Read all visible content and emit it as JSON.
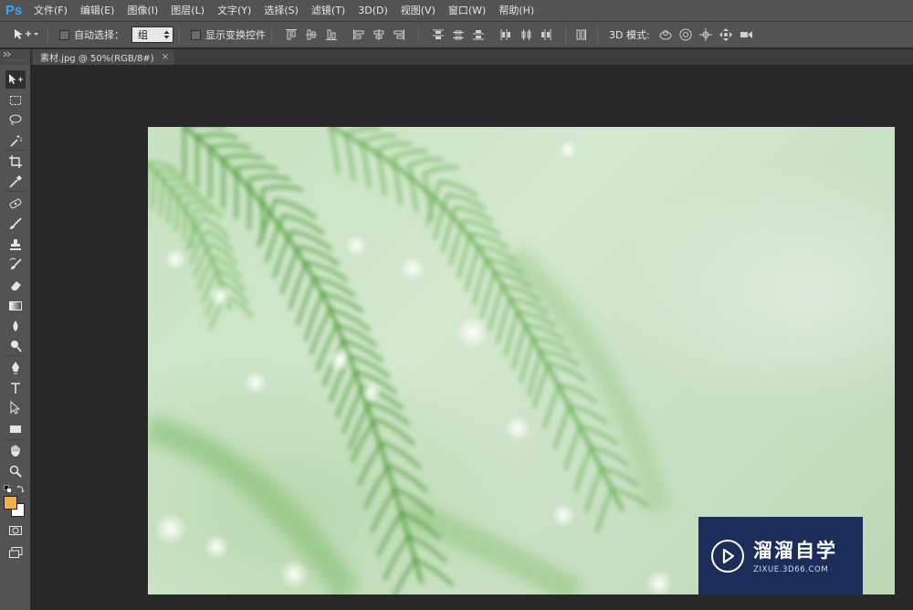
{
  "app": {
    "logo": "Ps",
    "menu": [
      "文件(F)",
      "编辑(E)",
      "图像(I)",
      "图层(L)",
      "文字(Y)",
      "选择(S)",
      "滤镜(T)",
      "3D(D)",
      "视图(V)",
      "窗口(W)",
      "帮助(H)"
    ]
  },
  "options": {
    "auto_select_label": "自动选择：",
    "auto_select_value": "组",
    "show_transform_label": "显示变换控件",
    "mode_label": "3D 模式:"
  },
  "document": {
    "tab_label": "素材.jpg @ 50%(RGB/8#)",
    "close_glyph": "×"
  },
  "colors": {
    "foreground": "#f0b04a",
    "background": "#ffffff",
    "ui_panel": "#535353",
    "workspace": "#282828"
  },
  "tools": [
    "move-tool-icon",
    "marquee-tool-icon",
    "lasso-tool-icon",
    "magic-wand-icon",
    "crop-tool-icon",
    "eyedropper-icon",
    "healing-brush-icon",
    "brush-tool-icon",
    "clone-stamp-icon",
    "history-brush-icon",
    "eraser-tool-icon",
    "gradient-tool-icon",
    "blur-tool-icon",
    "dodge-tool-icon",
    "pen-tool-icon",
    "type-tool-icon",
    "path-selection-icon",
    "rectangle-tool-icon",
    "hand-tool-icon",
    "zoom-tool-icon",
    "quick-mask-icon",
    "screen-mode-icon"
  ],
  "watermark": {
    "title": "溜溜自学",
    "url": "ZIXUE.3D66.COM"
  }
}
